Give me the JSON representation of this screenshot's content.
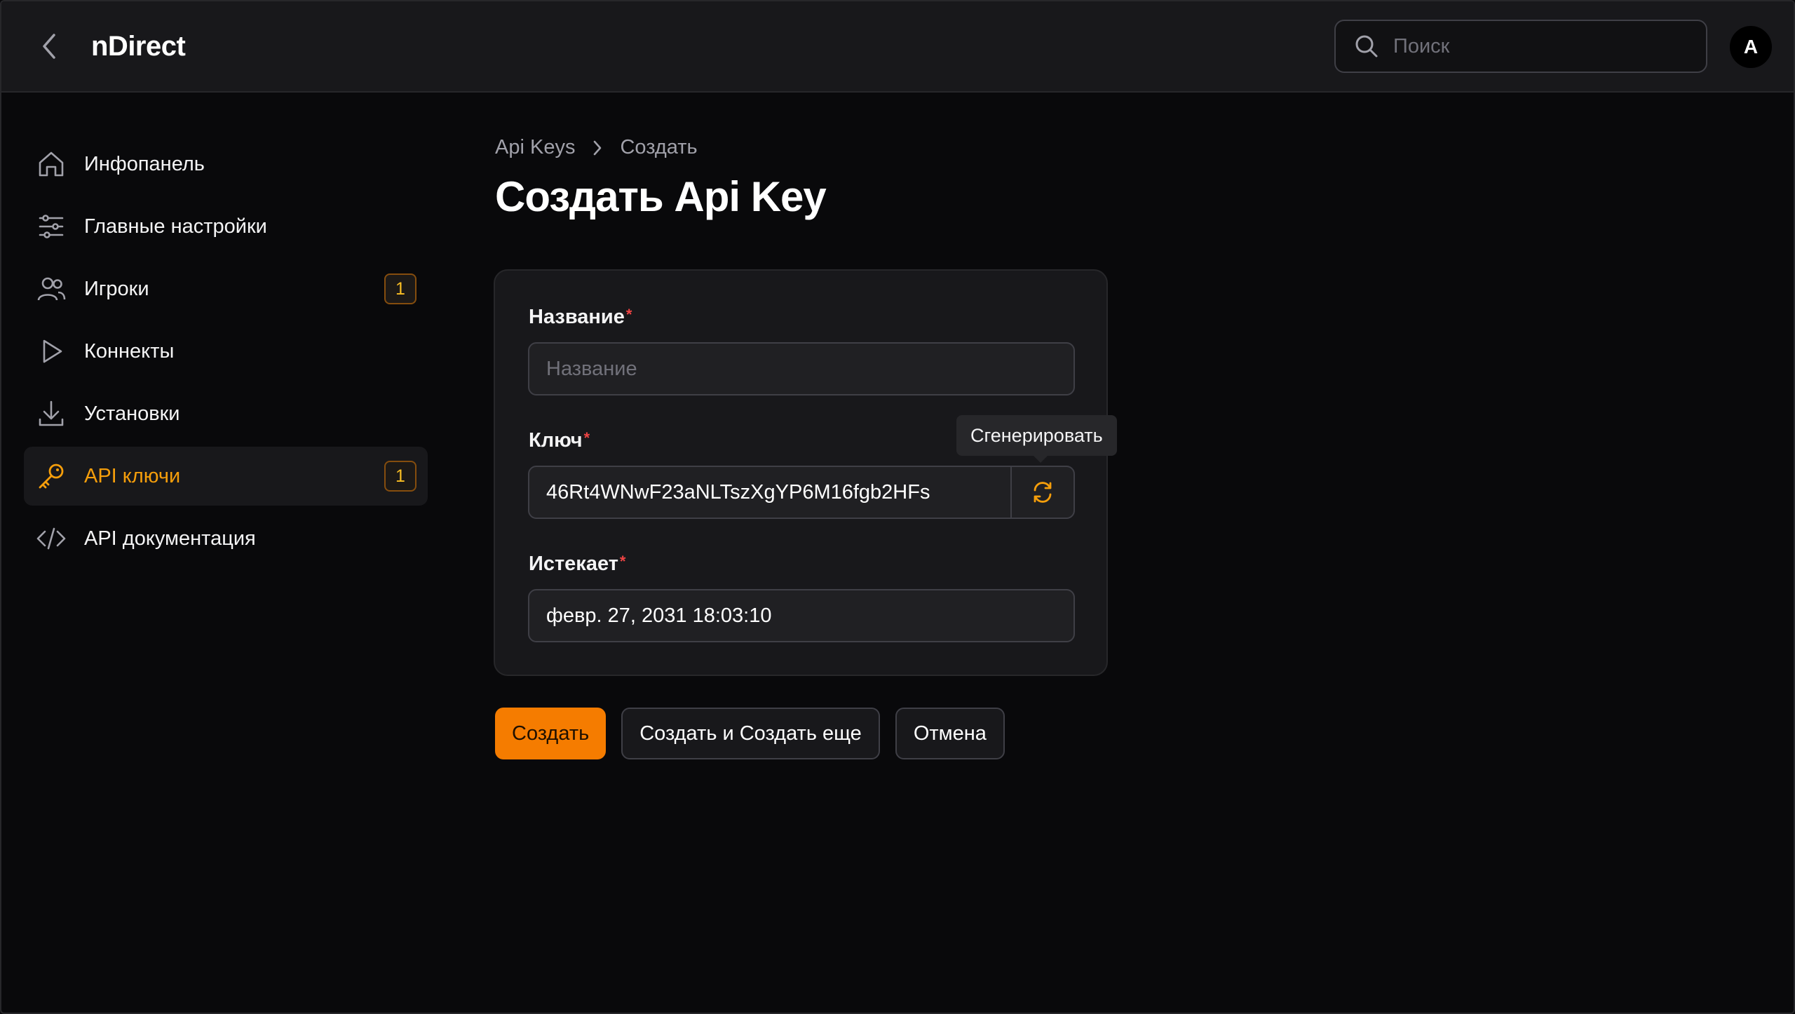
{
  "app": {
    "brand": "nDirect"
  },
  "header": {
    "search_placeholder": "Поиск",
    "avatar_initial": "A"
  },
  "sidebar": {
    "items": [
      {
        "label": "Инфопанель",
        "icon": "home-icon"
      },
      {
        "label": "Главные настройки",
        "icon": "sliders-icon"
      },
      {
        "label": "Игроки",
        "icon": "users-icon",
        "badge": "1"
      },
      {
        "label": "Коннекты",
        "icon": "play-icon"
      },
      {
        "label": "Установки",
        "icon": "download-icon"
      },
      {
        "label": "API ключи",
        "icon": "key-icon",
        "badge": "1",
        "active": true
      },
      {
        "label": "API документация",
        "icon": "code-icon"
      }
    ]
  },
  "breadcrumb": {
    "parent": "Api Keys",
    "current": "Создать"
  },
  "page": {
    "title": "Создать Api Key"
  },
  "form": {
    "name": {
      "label": "Название",
      "required": "*",
      "placeholder": "Название",
      "value": ""
    },
    "key": {
      "label": "Ключ",
      "required": "*",
      "value": "46Rt4WNwF23aNLTszXgYP6M16fgb2HFs",
      "tooltip": "Сгенерировать"
    },
    "expires": {
      "label": "Истекает",
      "required": "*",
      "value": "февр. 27, 2031 18:03:10"
    }
  },
  "actions": {
    "create": "Создать",
    "create_another": "Создать и Создать еще",
    "cancel": "Отмена"
  },
  "colors": {
    "accent": "#f59e0b",
    "primary_button": "#f57c00",
    "required": "#ef4444",
    "background": "#09090b"
  }
}
